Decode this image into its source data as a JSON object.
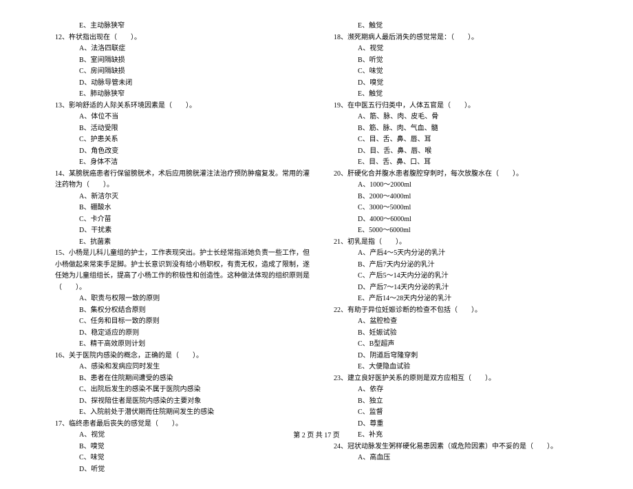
{
  "left_column": {
    "opt_11e": "E、主动脉狭窄",
    "q12": "12、杵状指出现在（　　）。",
    "q12a": "A、法洛四联症",
    "q12b": "B、室间隔缺损",
    "q12c": "C、房间隔缺损",
    "q12d": "D、动脉导管未闭",
    "q12e": "E、肺动脉狭窄",
    "q13": "13、影响舒适的人际关系环境因素是（　　）。",
    "q13a": "A、体位不当",
    "q13b": "B、活动受限",
    "q13c": "C、护患关系",
    "q13d": "D、角色改变",
    "q13e": "E、身体不洁",
    "q14": "14、某膀胱癌患者行保留膀胱术，术后应用膀胱灌注法治疗预防肿瘤复发。常用的灌注药物为（　　）。",
    "q14a": "A、新洁尔灭",
    "q14b": "B、硼酸水",
    "q14c": "C、卡介苗",
    "q14d": "D、干扰素",
    "q14e": "E、抗菌素",
    "q15": "15、小杨是儿科儿童组的护士，工作表现突出。护士长经常指派她负责一些工作，但小杨做起来常束手足脚。护士长意识到没有给小杨职权，有责无权，造成了限制，遂任她为儿童组组长，提高了小杨工作的积极性和创造性。这种做法体现的组织原则是（　　）。",
    "q15a": "A、职责与权限一致的原则",
    "q15b": "B、集权分权结合原则",
    "q15c": "C、任务和目标一致的原则",
    "q15d": "D、稳定适应的原则",
    "q15e": "E、精干高效原则计划",
    "q16": "16、关于医院内感染的概念，正确的是（　　）。",
    "q16a": "A、感染和发病应同时发生",
    "q16b": "B、患者在住院期间遭受的感染",
    "q16c": "C、出院后发生的感染不属于医院内感染",
    "q16d": "D、探视陪住者是医院内感染的主要对象",
    "q16e": "E、入院前处于潜伏期而住院期间发生的感染",
    "q17": "17、临终患者最后丧失的感觉是（　　）。",
    "q17a": "A、视觉",
    "q17b": "B、嗅觉",
    "q17c": "C、味觉",
    "q17d": "D、听觉"
  },
  "right_column": {
    "q17e": "E、触觉",
    "q18": "18、濒死期病人最后消失的感觉常是：（　　）。",
    "q18a": "A、视觉",
    "q18b": "B、听觉",
    "q18c": "C、味觉",
    "q18d": "D、嗅觉",
    "q18e": "E、触觉",
    "q19": "19、在中医五行归类中，人体五官是（　　）。",
    "q19a": "A、筋、脉、肉、皮毛、骨",
    "q19b": "B、筋、脉、肉、气血、髓",
    "q19c": "C、目、舌、鼻、唇、耳",
    "q19d": "D、目、舌、鼻、唇、喉",
    "q19e": "E、目、舌、鼻、口、耳",
    "q20": "20、肝硬化合并腹水患者腹腔穿刺时，每次放腹水在（　　）。",
    "q20a": "A、1000～2000ml",
    "q20b": "B、2000～4000ml",
    "q20c": "C、3000～5000ml",
    "q20d": "D、4000～6000ml",
    "q20e": "E、5000～6000ml",
    "q21": "21、初乳是指（　　）。",
    "q21a": "A、产后4～5天内分泌的乳汁",
    "q21b": "B、产后7天内分泌的乳汁",
    "q21c": "C、产后5～14天内分泌的乳汁",
    "q21d": "D、产后7～14天内分泌的乳汁",
    "q21e": "E、产后14～28天内分泌的乳汁",
    "q22": "22、有助于异位妊娠诊断的检查不包括（　　）。",
    "q22a": "A、盆腔检查",
    "q22b": "B、妊娠试验",
    "q22c": "C、B型超声",
    "q22d": "D、阴道后穹隆穿刺",
    "q22e": "E、大便隐血试验",
    "q23": "23、建立良好医护关系的原则是双方应相互（　　）。",
    "q23a": "A、依存",
    "q23b": "B、独立",
    "q23c": "C、监督",
    "q23d": "D、尊重",
    "q23e": "E、补充",
    "q24": "24、冠状动脉发生粥样硬化易患因素（或危险因素）中不妥的是（　　）。",
    "q24a": "A、高血压"
  },
  "footer": "第 2 页 共 17 页"
}
